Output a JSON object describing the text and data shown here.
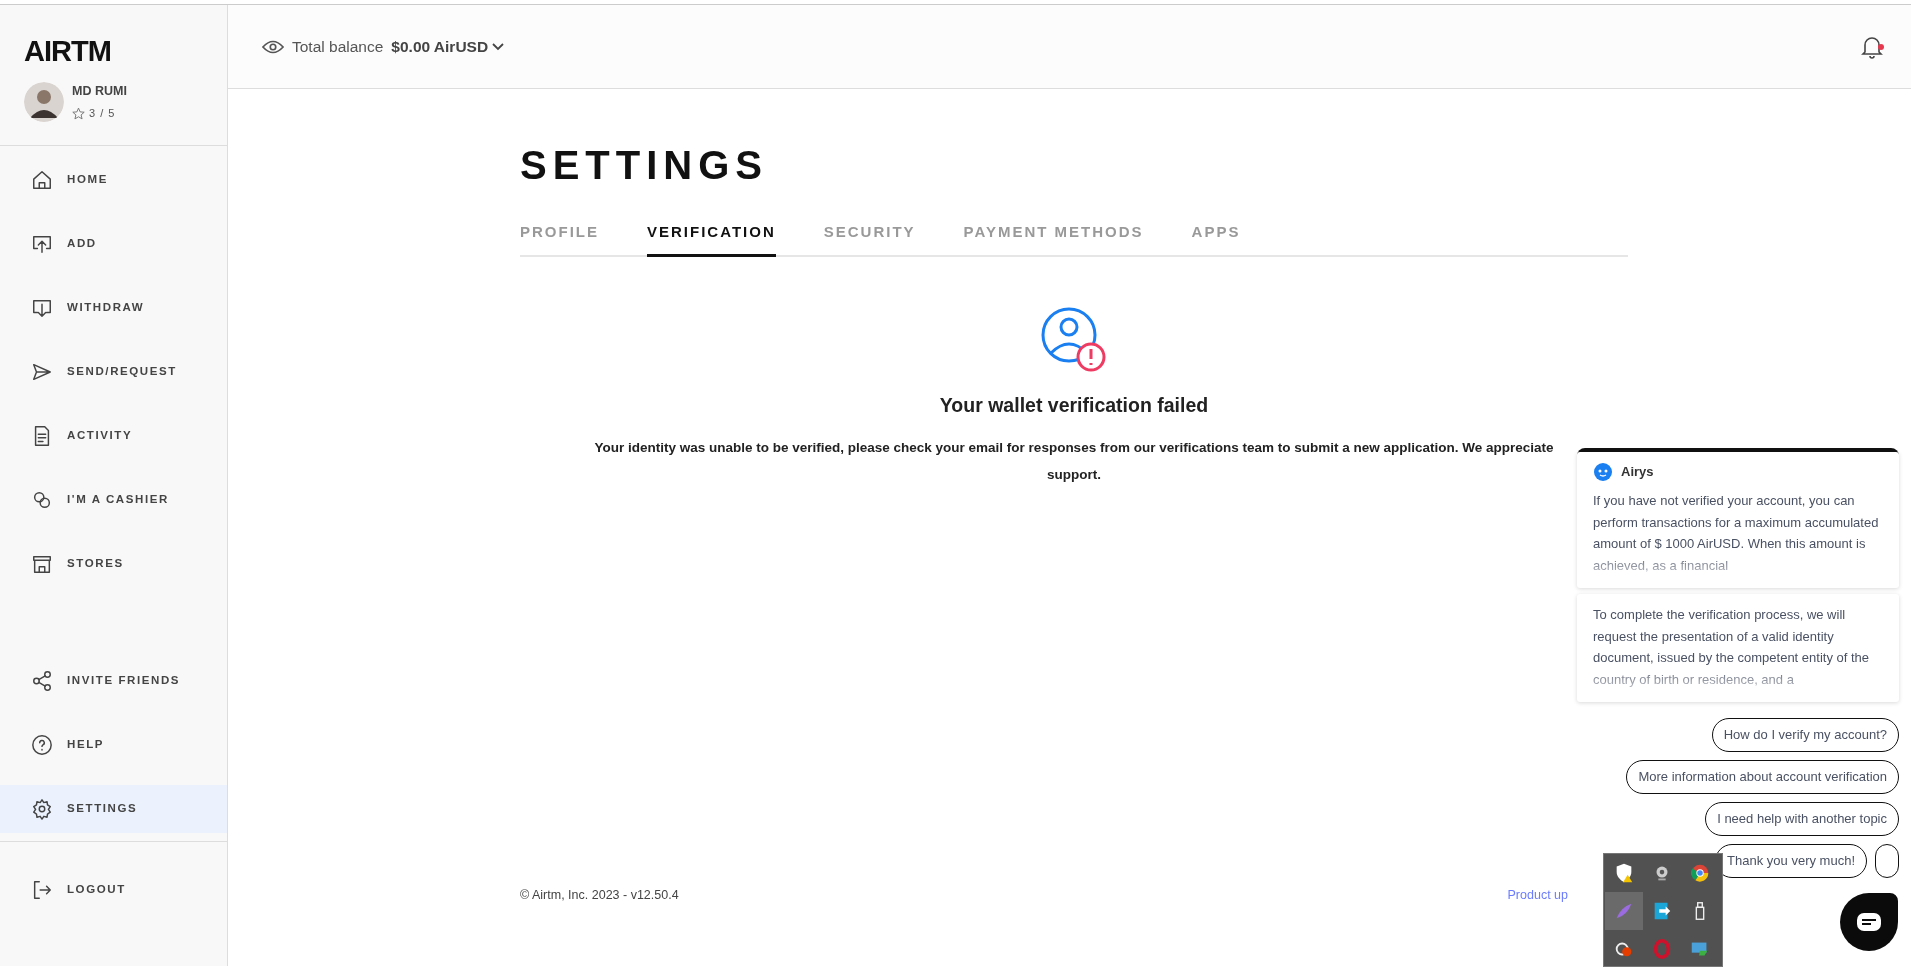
{
  "brand": {
    "logo": "AIRTM"
  },
  "user": {
    "name": "MD RUMI",
    "rating": "3 / 5"
  },
  "nav_sections": [
    {
      "items": [
        {
          "label": "HOME",
          "kind": "home",
          "selected": false
        },
        {
          "label": "ADD",
          "kind": "add",
          "selected": false
        },
        {
          "label": "WITHDRAW",
          "kind": "withdraw",
          "selected": false
        },
        {
          "label": "SEND/REQUEST",
          "kind": "send",
          "selected": false
        },
        {
          "label": "ACTIVITY",
          "kind": "activity",
          "selected": false
        },
        {
          "label": "I'M A CASHIER",
          "kind": "cashier",
          "selected": false
        },
        {
          "label": "STORES",
          "kind": "store",
          "selected": false
        }
      ]
    },
    {
      "items": [
        {
          "label": "INVITE FRIENDS",
          "kind": "share",
          "selected": false
        },
        {
          "label": "HELP",
          "kind": "help",
          "selected": false
        },
        {
          "label": "SETTINGS",
          "kind": "gear",
          "selected": true
        }
      ]
    },
    {
      "items": [
        {
          "label": "LOGOUT",
          "kind": "logout",
          "selected": false
        }
      ]
    }
  ],
  "header": {
    "balance_label": "Total balance",
    "balance": "$0.00 AirUSD",
    "notification_unread": true
  },
  "page": {
    "title": "SETTINGS",
    "tabs": [
      {
        "label": "PROFILE",
        "selected": false
      },
      {
        "label": "VERIFICATION",
        "selected": true
      },
      {
        "label": "SECURITY",
        "selected": false
      },
      {
        "label": "PAYMENT METHODS",
        "selected": false
      },
      {
        "label": "APPS",
        "selected": false
      }
    ],
    "status": {
      "heading": "Your wallet verification failed",
      "message_lines": [
        "Your identity was unable to be verified, please check your email for responses from our verifications team to submit a new application. We appreciate",
        "support."
      ]
    }
  },
  "footer": {
    "copyright": "© Airtm, Inc. 2023 - v12.50.4",
    "link": "Product up"
  },
  "chat": {
    "bot_name": "Airys",
    "messages": [
      "If you have not verified your account, you can perform transactions for a maximum accumulated amount of $ 1000 AirUSD. When this amount is achieved, as a financial",
      "To complete the verification process, we will request the presentation of a valid identity document, issued by the competent entity of the country of birth or residence, and a"
    ],
    "quick_replies": [
      {
        "kind": "text",
        "label": "How do I verify my account?"
      },
      {
        "kind": "text",
        "label": "More information about account verification"
      },
      {
        "kind": "text",
        "label": "I need help with another topic"
      },
      {
        "kind": "text",
        "label": "Thank you very much!"
      },
      {
        "kind": "blank"
      }
    ]
  },
  "tray": {
    "icons": [
      {
        "kind": "shield",
        "selected": false
      },
      {
        "kind": "webcam",
        "selected": false
      },
      {
        "kind": "browser",
        "selected": false
      },
      {
        "kind": "feather",
        "selected": true
      },
      {
        "kind": "transfer",
        "selected": false
      },
      {
        "kind": "usb",
        "selected": false
      },
      {
        "kind": "record",
        "selected": false
      },
      {
        "kind": "ring",
        "selected": false
      },
      {
        "kind": "monitor",
        "selected": false
      }
    ]
  }
}
